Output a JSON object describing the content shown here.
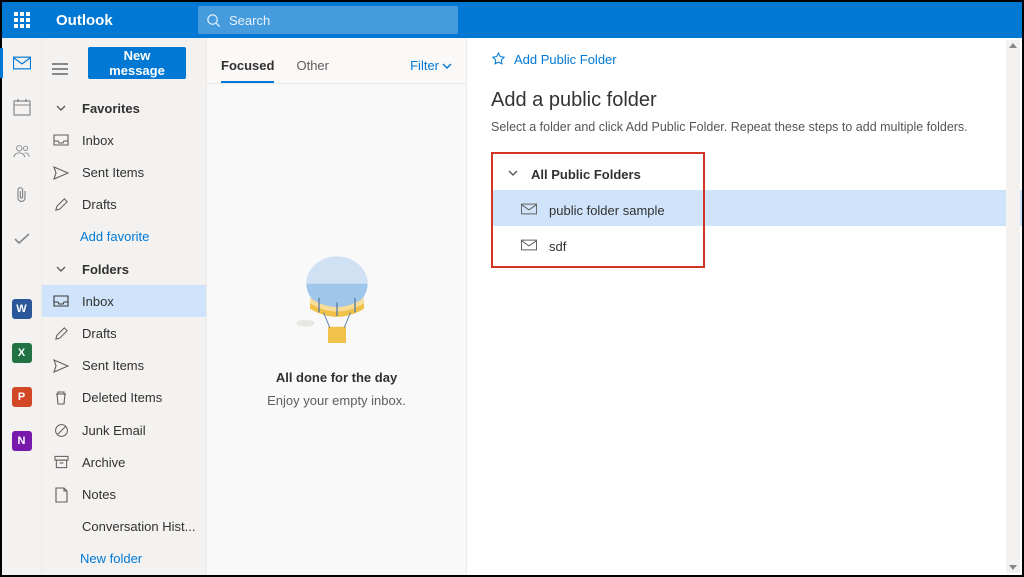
{
  "header": {
    "brand": "Outlook",
    "search_placeholder": "Search"
  },
  "sidebar": {
    "new_message": "New message",
    "favorites_label": "Favorites",
    "favorites": [
      {
        "label": "Inbox"
      },
      {
        "label": "Sent Items"
      },
      {
        "label": "Drafts"
      }
    ],
    "add_favorite": "Add favorite",
    "folders_label": "Folders",
    "folders": [
      {
        "label": "Inbox"
      },
      {
        "label": "Drafts"
      },
      {
        "label": "Sent Items"
      },
      {
        "label": "Deleted Items"
      },
      {
        "label": "Junk Email"
      },
      {
        "label": "Archive"
      },
      {
        "label": "Notes"
      },
      {
        "label": "Conversation Hist..."
      }
    ],
    "new_folder": "New folder"
  },
  "msglist": {
    "tab_focused": "Focused",
    "tab_other": "Other",
    "filter": "Filter",
    "empty_title": "All done for the day",
    "empty_sub": "Enjoy your empty inbox."
  },
  "flyout": {
    "add_link": "Add Public Folder",
    "title": "Add a public folder",
    "desc": "Select a folder and click Add Public Folder. Repeat these steps to add multiple folders.",
    "tree_header": "All Public Folders",
    "items": [
      {
        "label": "public folder sample"
      },
      {
        "label": "sdf"
      }
    ]
  }
}
